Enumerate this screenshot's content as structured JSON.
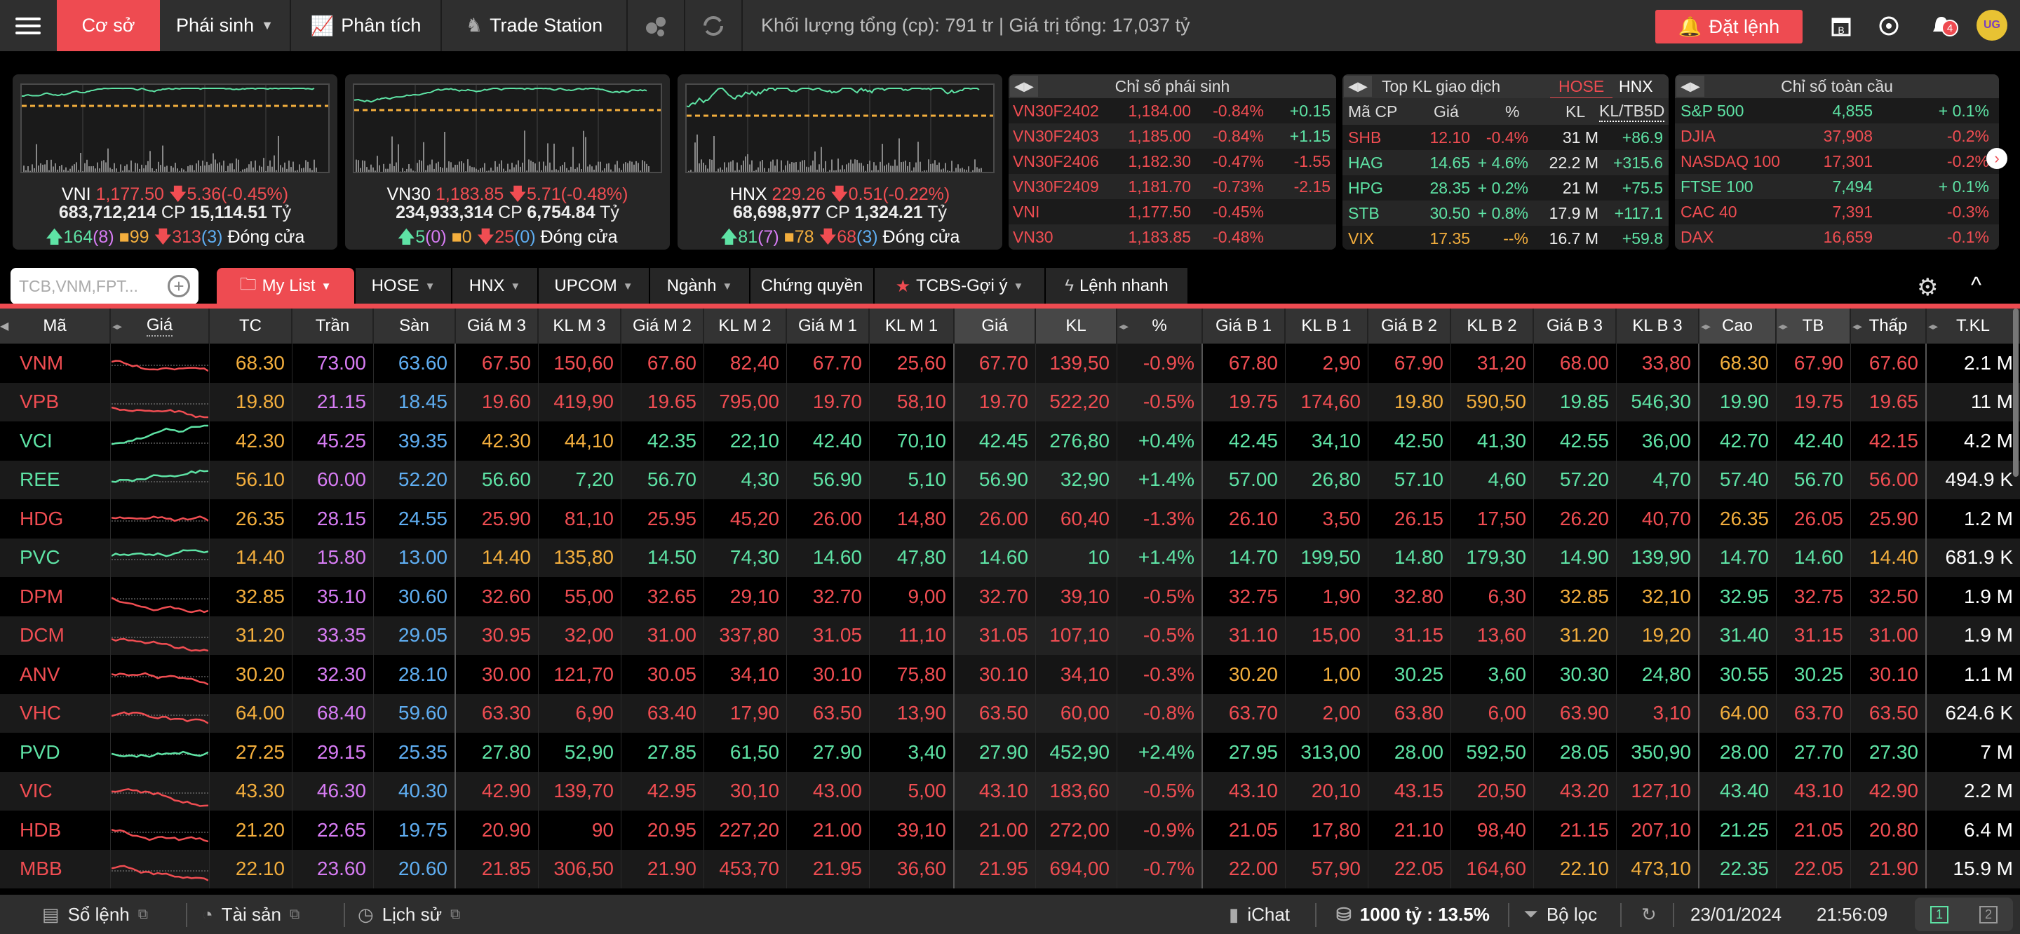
{
  "topbar": {
    "menu_icon": "hamburger-icon",
    "tabs": [
      {
        "label": "Cơ sở",
        "active": true
      },
      {
        "label": "Phái sinh"
      },
      {
        "label": "Phân tích"
      },
      {
        "label": "Trade Station"
      }
    ],
    "summary": "Khối lượng tổng (cp): 791 tr | Giá trị tổng: 17,037 tỷ",
    "order_button": "Đặt lệnh",
    "notification_count": "4",
    "avatar_text": "UG"
  },
  "colors": {
    "up": "#5ee3a5",
    "down": "#f04d52",
    "ref": "#f3ae3d",
    "ceil": "#d77cf4",
    "floor": "#5faef2",
    "accent": "#ee4b51"
  },
  "indices": [
    {
      "name": "VNI",
      "value": "1,177.50",
      "change": "5.36(-0.45%)",
      "volume": "683,712,214",
      "volume_unit": "CP",
      "valuetrade": "15,114.51",
      "value_unit": "Tỷ",
      "up": "164",
      "up_ceil": "(8)",
      "flat": "99",
      "down": "313",
      "down_floor": "(3)",
      "status": "Đóng cửa"
    },
    {
      "name": "VN30",
      "value": "1,183.85",
      "change": "5.71(-0.48%)",
      "volume": "234,933,314",
      "volume_unit": "CP",
      "valuetrade": "6,754.84",
      "value_unit": "Tỷ",
      "up": "5",
      "up_ceil": "(0)",
      "flat": "0",
      "down": "25",
      "down_floor": "(0)",
      "status": "Đóng cửa"
    },
    {
      "name": "HNX",
      "value": "229.26",
      "change": "0.51(-0.22%)",
      "volume": "68,698,977",
      "volume_unit": "CP",
      "valuetrade": "1,324.21",
      "value_unit": "Tỷ",
      "up": "81",
      "up_ceil": "(7)",
      "flat": "78",
      "down": "68",
      "down_floor": "(3)",
      "status": "Đóng cửa"
    }
  ],
  "derivatives": {
    "title": "Chỉ số phái sinh",
    "rows": [
      {
        "name": "VN30F2402",
        "price": "1,184.00",
        "pct": "-0.84%",
        "diff": "+0.15"
      },
      {
        "name": "VN30F2403",
        "price": "1,185.00",
        "pct": "-0.84%",
        "diff": "+1.15"
      },
      {
        "name": "VN30F2406",
        "price": "1,182.30",
        "pct": "-0.47%",
        "diff": "-1.55"
      },
      {
        "name": "VN30F2409",
        "price": "1,181.70",
        "pct": "-0.73%",
        "diff": "-2.15"
      },
      {
        "name": "VNI",
        "price": "1,177.50",
        "pct": "-0.45%",
        "diff": ""
      },
      {
        "name": "VN30",
        "price": "1,183.85",
        "pct": "-0.48%",
        "diff": ""
      }
    ]
  },
  "topkl": {
    "title": "Top KL giao dịch",
    "tabs": [
      "HOSE",
      "HNX"
    ],
    "headers": [
      "Mã CP",
      "Giá",
      "%",
      "KL",
      "KL/TB5D"
    ],
    "rows": [
      {
        "sym": "SHB",
        "price": "12.10",
        "pct": "-0.4%",
        "kl": "31 M",
        "ratio": "+86.9",
        "c": "down"
      },
      {
        "sym": "HAG",
        "price": "14.65",
        "pct": "+ 4.6%",
        "kl": "22.2 M",
        "ratio": "+315.6",
        "c": "up"
      },
      {
        "sym": "HPG",
        "price": "28.35",
        "pct": "+ 0.2%",
        "kl": "21 M",
        "ratio": "+75.5",
        "c": "up"
      },
      {
        "sym": "STB",
        "price": "30.50",
        "pct": "+ 0.8%",
        "kl": "17.9 M",
        "ratio": "+117.1",
        "c": "up"
      },
      {
        "sym": "VIX",
        "price": "17.35",
        "pct": "--%",
        "kl": "16.7 M",
        "ratio": "+59.8",
        "c": "ref"
      }
    ]
  },
  "global": {
    "title": "Chỉ số toàn cầu",
    "rows": [
      {
        "name": "S&P 500",
        "value": "4,855",
        "pct": "+ 0.1%",
        "c": "up"
      },
      {
        "name": "DJIA",
        "value": "37,908",
        "pct": "-0.2%",
        "c": "down"
      },
      {
        "name": "NASDAQ 100",
        "value": "17,301",
        "pct": "-0.2%",
        "c": "down"
      },
      {
        "name": "FTSE 100",
        "value": "7,494",
        "pct": "+ 0.1%",
        "c": "up"
      },
      {
        "name": "CAC 40",
        "value": "7,391",
        "pct": "-0.3%",
        "c": "down"
      },
      {
        "name": "DAX",
        "value": "16,659",
        "pct": "-0.1%",
        "c": "down"
      }
    ]
  },
  "toolbar": {
    "search_placeholder": "TCB,VNM,FPT...",
    "tabs": [
      "My List",
      "HOSE",
      "HNX",
      "UPCOM",
      "Ngành",
      "Chứng quyền",
      "TCBS-Gợi ý",
      "Lệnh nhanh"
    ]
  },
  "table": {
    "headers": [
      "Mã",
      "Giá",
      "TC",
      "Trần",
      "Sàn",
      "Giá M 3",
      "KL M 3",
      "Giá M 2",
      "KL M 2",
      "Giá M 1",
      "KL M 1",
      "Giá",
      "KL",
      "%",
      "Giá B 1",
      "KL B 1",
      "Giá B 2",
      "KL B 2",
      "Giá B 3",
      "KL B 3",
      "Cao",
      "TB",
      "Thấp",
      "T.KL"
    ],
    "rows": [
      [
        "VNM",
        "68.30",
        "73.00",
        "63.60",
        "67.50",
        "150,60",
        "67.60",
        "82,40",
        "67.70",
        "25,60",
        "67.70",
        "139,50",
        "-0.9%",
        "67.80",
        "2,90",
        "67.90",
        "31,20",
        "68.00",
        "33,80",
        "68.30",
        "67.90",
        "67.60",
        "2.1 M"
      ],
      [
        "VPB",
        "19.80",
        "21.15",
        "18.45",
        "19.60",
        "419,90",
        "19.65",
        "795,00",
        "19.70",
        "58,10",
        "19.70",
        "522,20",
        "-0.5%",
        "19.75",
        "174,60",
        "19.80",
        "590,50",
        "19.85",
        "546,30",
        "19.90",
        "19.75",
        "19.65",
        "11 M"
      ],
      [
        "VCI",
        "42.30",
        "45.25",
        "39.35",
        "42.30",
        "44,10",
        "42.35",
        "22,10",
        "42.40",
        "70,10",
        "42.45",
        "276,80",
        "+0.4%",
        "42.45",
        "34,10",
        "42.50",
        "41,30",
        "42.55",
        "36,00",
        "42.70",
        "42.40",
        "42.15",
        "4.2 M"
      ],
      [
        "REE",
        "56.10",
        "60.00",
        "52.20",
        "56.60",
        "7,20",
        "56.70",
        "4,30",
        "56.90",
        "5,10",
        "56.90",
        "32,90",
        "+1.4%",
        "57.00",
        "26,80",
        "57.10",
        "4,60",
        "57.20",
        "4,70",
        "57.40",
        "56.70",
        "56.00",
        "494.9 K"
      ],
      [
        "HDG",
        "26.35",
        "28.15",
        "24.55",
        "25.90",
        "81,10",
        "25.95",
        "45,20",
        "26.00",
        "14,80",
        "26.00",
        "60,40",
        "-1.3%",
        "26.10",
        "3,50",
        "26.15",
        "17,50",
        "26.20",
        "40,70",
        "26.35",
        "26.05",
        "25.90",
        "1.2 M"
      ],
      [
        "PVC",
        "14.40",
        "15.80",
        "13.00",
        "14.40",
        "135,80",
        "14.50",
        "74,30",
        "14.60",
        "47,80",
        "14.60",
        "10",
        "+1.4%",
        "14.70",
        "199,50",
        "14.80",
        "179,30",
        "14.90",
        "139,90",
        "14.70",
        "14.60",
        "14.40",
        "681.9 K"
      ],
      [
        "DPM",
        "32.85",
        "35.10",
        "30.60",
        "32.60",
        "55,00",
        "32.65",
        "29,10",
        "32.70",
        "9,00",
        "32.70",
        "39,10",
        "-0.5%",
        "32.75",
        "1,90",
        "32.80",
        "6,30",
        "32.85",
        "32,10",
        "32.95",
        "32.75",
        "32.50",
        "1.9 M"
      ],
      [
        "DCM",
        "31.20",
        "33.35",
        "29.05",
        "30.95",
        "32,00",
        "31.00",
        "337,80",
        "31.05",
        "11,10",
        "31.05",
        "107,10",
        "-0.5%",
        "31.10",
        "15,00",
        "31.15",
        "13,60",
        "31.20",
        "19,20",
        "31.40",
        "31.15",
        "31.00",
        "1.9 M"
      ],
      [
        "ANV",
        "30.20",
        "32.30",
        "28.10",
        "30.00",
        "121,70",
        "30.05",
        "34,10",
        "30.10",
        "75,80",
        "30.10",
        "34,10",
        "-0.3%",
        "30.20",
        "1,00",
        "30.25",
        "3,60",
        "30.30",
        "24,80",
        "30.55",
        "30.25",
        "30.10",
        "1.1 M"
      ],
      [
        "VHC",
        "64.00",
        "68.40",
        "59.60",
        "63.30",
        "6,90",
        "63.40",
        "17,90",
        "63.50",
        "13,90",
        "63.50",
        "60,00",
        "-0.8%",
        "63.70",
        "2,00",
        "63.80",
        "6,00",
        "63.90",
        "3,10",
        "64.00",
        "63.70",
        "63.50",
        "624.6 K"
      ],
      [
        "PVD",
        "27.25",
        "29.15",
        "25.35",
        "27.80",
        "52,90",
        "27.85",
        "61,50",
        "27.90",
        "3,40",
        "27.90",
        "452,90",
        "+2.4%",
        "27.95",
        "313,00",
        "28.00",
        "592,50",
        "28.05",
        "350,90",
        "28.00",
        "27.70",
        "27.30",
        "7 M"
      ],
      [
        "VIC",
        "43.30",
        "46.30",
        "40.30",
        "42.90",
        "139,70",
        "42.95",
        "30,10",
        "43.00",
        "5,00",
        "43.10",
        "183,60",
        "-0.5%",
        "43.10",
        "20,10",
        "43.15",
        "20,50",
        "43.20",
        "127,10",
        "43.40",
        "43.10",
        "42.90",
        "2.2 M"
      ],
      [
        "HDB",
        "21.20",
        "22.65",
        "19.75",
        "20.90",
        "90",
        "20.95",
        "227,20",
        "21.00",
        "39,10",
        "21.00",
        "272,00",
        "-0.9%",
        "21.05",
        "17,80",
        "21.10",
        "98,40",
        "21.15",
        "207,10",
        "21.25",
        "21.05",
        "20.80",
        "6.4 M"
      ],
      [
        "MBB",
        "22.10",
        "23.60",
        "20.60",
        "21.85",
        "306,50",
        "21.90",
        "453,70",
        "21.95",
        "36,60",
        "21.95",
        "694,00",
        "-0.7%",
        "22.00",
        "57,90",
        "22.05",
        "164,60",
        "22.10",
        "473,10",
        "22.35",
        "22.05",
        "21.90",
        "15.9 M"
      ]
    ]
  },
  "footer": {
    "order_book": "Sổ lệnh",
    "assets": "Tài sản",
    "history": "Lịch sử",
    "chat": "iChat",
    "threshold": "1000 tỷ : 13.5%",
    "filter": "Bộ lọc",
    "date": "23/01/2024",
    "time": "21:56:09",
    "screen1": "1",
    "screen2": "2"
  }
}
